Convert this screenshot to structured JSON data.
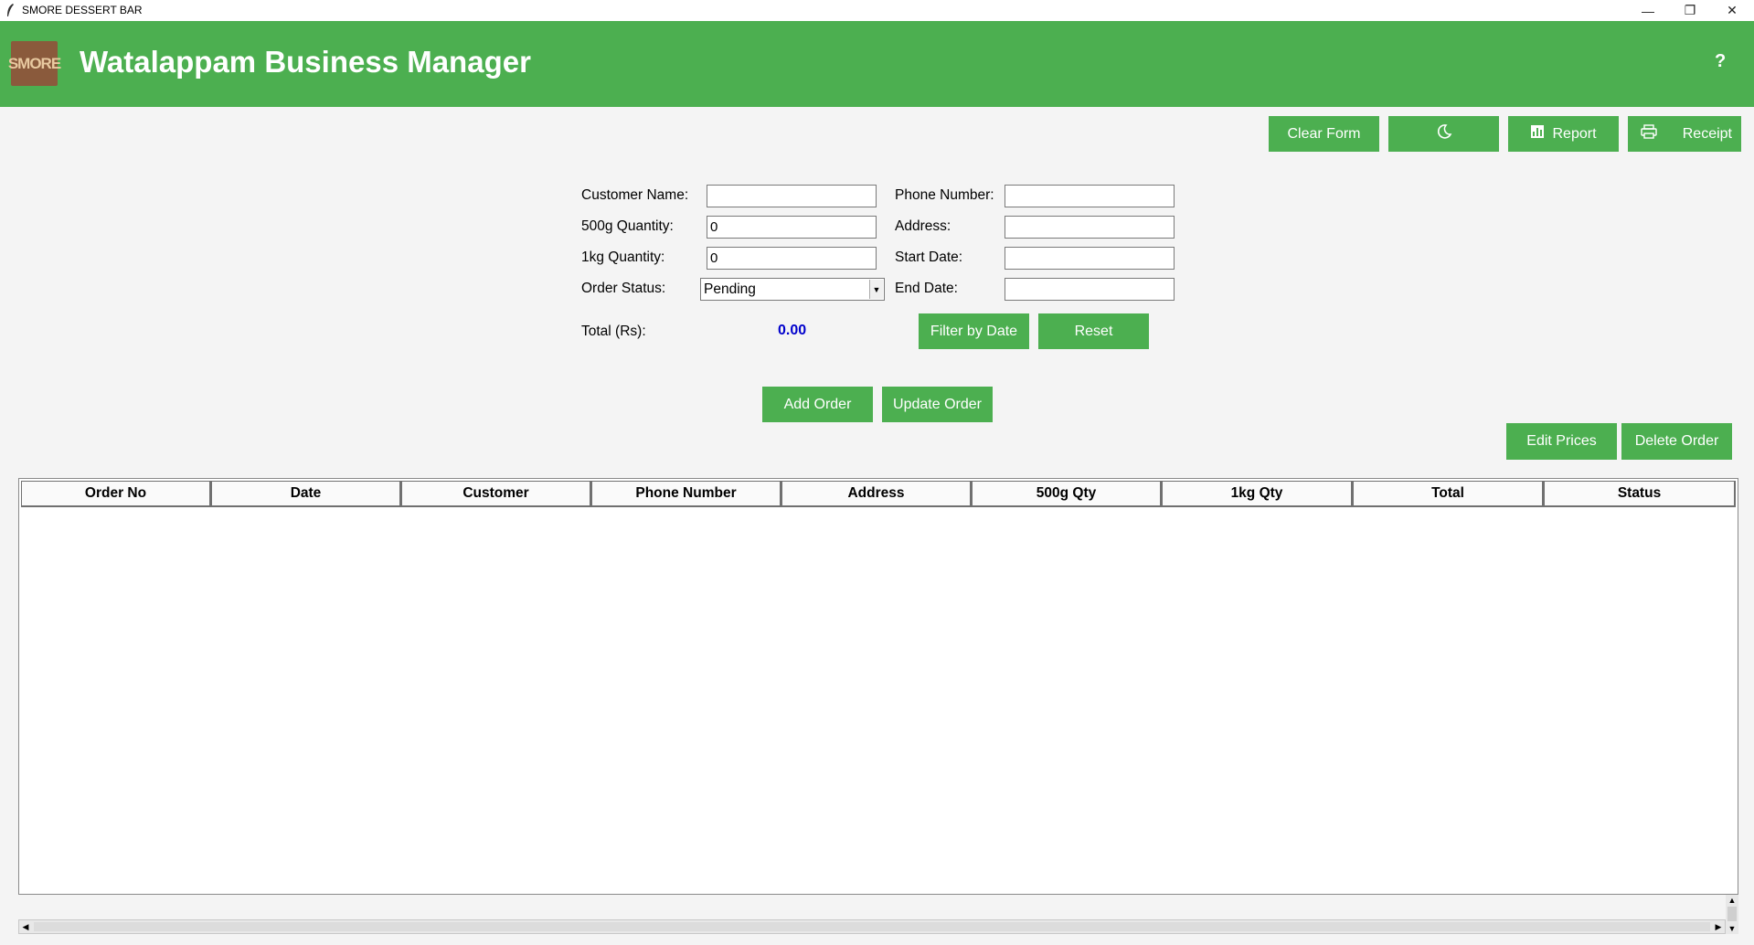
{
  "window": {
    "title": "SMORE DESSERT BAR",
    "controls": {
      "minimize": "—",
      "restore": "❐",
      "close": "✕"
    }
  },
  "header": {
    "logo_text": "SMORE",
    "title": "Watalappam Business Manager",
    "help": "?"
  },
  "toolbar": {
    "clear_form": "Clear Form",
    "theme_icon": "moon-icon",
    "report": "Report",
    "receipt": "Receipt"
  },
  "form": {
    "customer_name": {
      "label": "Customer Name:",
      "value": ""
    },
    "phone_number": {
      "label": "Phone Number:",
      "value": ""
    },
    "qty_500g": {
      "label": "500g Quantity:",
      "value": "0"
    },
    "address": {
      "label": "Address:",
      "value": ""
    },
    "qty_1kg": {
      "label": "1kg Quantity:",
      "value": "0"
    },
    "start_date": {
      "label": "Start Date:",
      "value": ""
    },
    "order_status": {
      "label": "Order Status:",
      "value": "Pending"
    },
    "end_date": {
      "label": "End Date:",
      "value": ""
    },
    "total": {
      "label": "Total (Rs):",
      "value": "0.00"
    },
    "filter_by_date": "Filter by Date",
    "reset": "Reset"
  },
  "actions": {
    "add_order": "Add Order",
    "update_order": "Update Order",
    "edit_prices": "Edit Prices",
    "delete_order": "Delete Order"
  },
  "table": {
    "columns": [
      "Order No",
      "Date",
      "Customer",
      "Phone Number",
      "Address",
      "500g Qty",
      "1kg Qty",
      "Total",
      "Status"
    ],
    "rows": []
  },
  "colors": {
    "accent": "#4caf50",
    "total_value": "#0000cc",
    "logo_bg": "#8a5a3c"
  }
}
